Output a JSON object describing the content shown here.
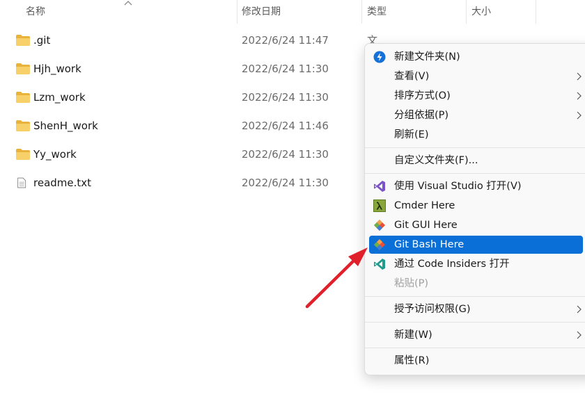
{
  "columns": {
    "name": "名称",
    "modified": "修改日期",
    "type": "类型",
    "size": "大小"
  },
  "files": [
    {
      "name": ".git",
      "modified": "2022/6/24 11:47",
      "type": "文件夹",
      "icon": "folder-icon"
    },
    {
      "name": "Hjh_work",
      "modified": "2022/6/24 11:30",
      "type": "",
      "icon": "folder-icon"
    },
    {
      "name": "Lzm_work",
      "modified": "2022/6/24 11:30",
      "type": "",
      "icon": "folder-icon"
    },
    {
      "name": "ShenH_work",
      "modified": "2022/6/24 11:46",
      "type": "",
      "icon": "folder-icon"
    },
    {
      "name": "Yy_work",
      "modified": "2022/6/24 11:30",
      "type": "",
      "icon": "folder-icon"
    },
    {
      "name": "readme.txt",
      "modified": "2022/6/24 11:30",
      "type": "",
      "icon": "text-file-icon"
    }
  ],
  "context_menu": {
    "new_folder": "新建文件夹(N)",
    "view": "查看(V)",
    "sort_by": "排序方式(O)",
    "group_by": "分组依据(P)",
    "refresh": "刷新(E)",
    "customize_folder": "自定义文件夹(F)...",
    "open_visual_studio": "使用 Visual Studio 打开(V)",
    "cmder_here": "Cmder Here",
    "git_gui_here": "Git GUI Here",
    "git_bash_here": "Git Bash Here",
    "open_code_insiders": "通过 Code Insiders 打开",
    "paste": "粘贴(P)",
    "grant_access": "授予访问权限(G)",
    "new": "新建(W)",
    "properties": "属性(R)"
  },
  "colors": {
    "highlight": "#0a6fd6",
    "annotation_arrow": "#e0202a",
    "folder": "#f5c242"
  }
}
